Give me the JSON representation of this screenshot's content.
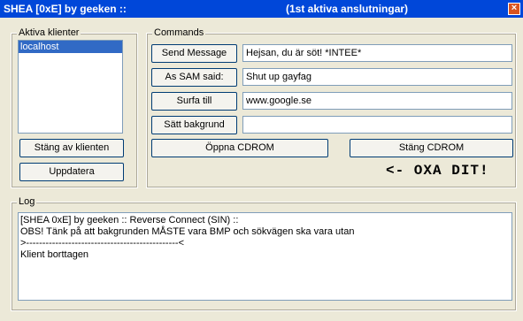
{
  "window": {
    "title": "SHEA [0xE] by geeken ::",
    "subtitle": "(1st aktiva anslutningar)",
    "close_glyph": "×"
  },
  "clients": {
    "legend": "Aktiva klienter",
    "items": [
      "localhost"
    ],
    "disconnect_label": "Stäng av klienten",
    "refresh_label": "Uppdatera"
  },
  "commands": {
    "legend": "Commands",
    "send_message_label": "Send Message",
    "send_message_value": "Hejsan, du är söt! *INTEE*",
    "as_sam_label": "As SAM said:",
    "as_sam_value": "Shut up gayfag",
    "surf_label": "Surfa till",
    "surf_value": "www.google.se",
    "wallpaper_label": "Sätt bakgrund",
    "wallpaper_value": "",
    "open_cdrom_label": "Öppna CDROM",
    "close_cdrom_label": "Stäng CDROM",
    "hint_text": "<- OXA DIT!"
  },
  "log": {
    "legend": "Log",
    "lines": [
      "[SHEA 0xE] by geeken :: Reverse Connect (SIN) ::",
      "OBS! Tänk på att bakgrunden MÅSTE vara BMP och sökvägen ska vara utan",
      ">-----------------------------------------------<",
      "Klient borttagen"
    ]
  }
}
